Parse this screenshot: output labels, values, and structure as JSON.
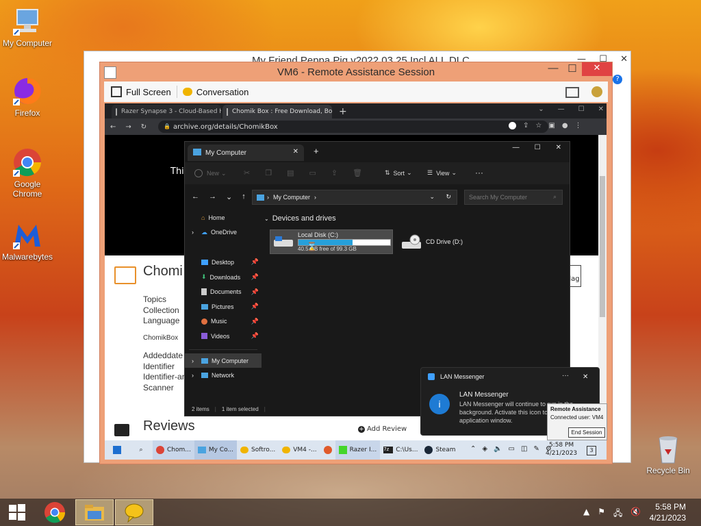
{
  "desktop": {
    "icons": [
      {
        "label": "My Computer",
        "icon": "computer-icon"
      },
      {
        "label": "Firefox",
        "icon": "firefox-icon"
      },
      {
        "label": "Google Chrome",
        "icon": "chrome-icon"
      },
      {
        "label": "Malwarebytes",
        "icon": "malwarebytes-icon"
      },
      {
        "label": "Recycle Bin",
        "icon": "recycle-bin-icon"
      }
    ]
  },
  "host_window": {
    "title": "My Friend Peppa Pig v2022.03.25 Incl ALL DLC"
  },
  "ra": {
    "title": "VM6 - Remote Assistance Session",
    "fullscreen_label": "Full Screen",
    "conversation_label": "Conversation"
  },
  "chrome": {
    "tab1": "Razer Synapse 3 - Cloud-Based H",
    "tab2": "Chomik Box : Free Download, Bo",
    "url": "archive.org/details/ChomikBox"
  },
  "webpage": {
    "banner_text": "Thi",
    "title": "Chomi",
    "meta_labels": [
      "Topics",
      "Collection",
      "Language"
    ],
    "item_name": "ChomikBox",
    "meta_labels2": [
      "Addeddate",
      "Identifier",
      "Identifier-ar",
      "Scanner"
    ],
    "reviews_heading": "Reviews",
    "add_review_label": "Add Review",
    "flag_label": "lag"
  },
  "explorer": {
    "tab_title": "My Computer",
    "new_label": "New",
    "sort_label": "Sort",
    "view_label": "View",
    "path": "My Computer",
    "search_placeholder": "Search My Computer",
    "section_title": "Devices and drives",
    "sidebar": [
      "Home",
      "OneDrive",
      "Desktop",
      "Downloads",
      "Documents",
      "Pictures",
      "Music",
      "Videos",
      "My Computer",
      "Network"
    ],
    "drive_c": {
      "name": "Local Disk (C:)",
      "free_text": "40.5 GB free of 99.3 GB",
      "used_fraction": 0.59
    },
    "drive_d": {
      "name": "CD Drive (D:)"
    },
    "status_items": "2 items",
    "status_selected": "1 item selected"
  },
  "inner_taskbar": {
    "buttons": [
      "Chom...",
      "My Co...",
      "Softro...",
      "VM4 -...",
      "Razer I...",
      "C:\\Us...",
      "Steam"
    ],
    "time": "5:58 PM",
    "date": "4/21/2023",
    "notification_count": "3"
  },
  "notification": {
    "app": "LAN Messenger",
    "title": "LAN Messenger",
    "body": "LAN Messenger will continue to run in the background. Activate this icon to restore the application window."
  },
  "remote_assist_box": {
    "title": "Remote Assistance",
    "connected": "Connected user:  VM4",
    "end_label": "End Session"
  },
  "host_taskbar": {
    "time": "5:58 PM",
    "date": "4/21/2023"
  }
}
